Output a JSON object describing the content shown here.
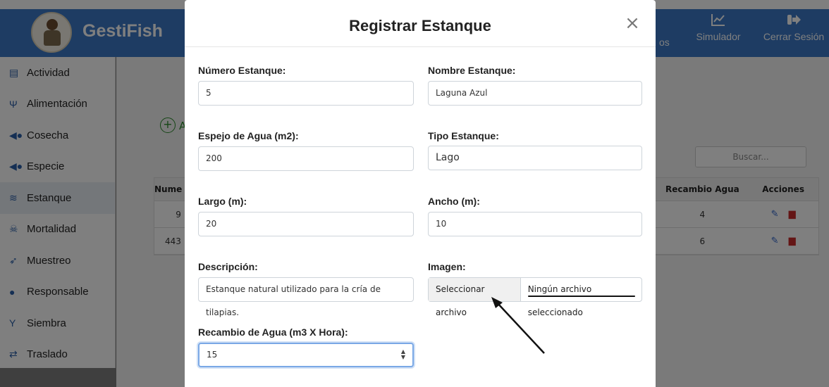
{
  "app": {
    "brand": "GestiFish",
    "top_nav": [
      {
        "label": "Simulador",
        "icon": "chart-line-icon"
      },
      {
        "label": "Cerrar Sesión",
        "icon": "sign-out-icon"
      }
    ],
    "nav_fragment": "os"
  },
  "sidebar": {
    "items": [
      {
        "label": "Actividad",
        "icon": "clipboard-icon"
      },
      {
        "label": "Alimentación",
        "icon": "utensils-icon"
      },
      {
        "label": "Cosecha",
        "icon": "fish-icon"
      },
      {
        "label": "Especie",
        "icon": "fish-icon"
      },
      {
        "label": "Estanque",
        "icon": "water-icon"
      },
      {
        "label": "Mortalidad",
        "icon": "skull-icon"
      },
      {
        "label": "Muestreo",
        "icon": "syringe-icon"
      },
      {
        "label": "Responsable",
        "icon": "user-icon"
      },
      {
        "label": "Siembra",
        "icon": "seedling-icon"
      },
      {
        "label": "Traslado",
        "icon": "exchange-icon"
      }
    ],
    "active": "Estanque"
  },
  "background_page": {
    "add_fragment": "A",
    "search_placeholder": "Buscar...",
    "table": {
      "headers": {
        "num": "Nume",
        "recambio": "Recambio Agua",
        "acciones": "Acciones"
      },
      "rows": [
        {
          "num": "9",
          "recambio": "4"
        },
        {
          "num": "443",
          "recambio": "6"
        }
      ]
    }
  },
  "modal": {
    "title": "Registrar Estanque",
    "fields": {
      "numero": {
        "label": "Número Estanque:",
        "value": "5"
      },
      "nombre": {
        "label": "Nombre Estanque:",
        "value": "Laguna Azul"
      },
      "espejo": {
        "label": "Espejo de Agua (m2):",
        "value": "200"
      },
      "tipo": {
        "label": "Tipo Estanque:",
        "value": "Lago"
      },
      "largo": {
        "label": "Largo (m):",
        "value": "20"
      },
      "ancho": {
        "label": "Ancho (m):",
        "value": "10"
      },
      "descripcion": {
        "label": "Descripción:",
        "value": "Estanque natural utilizado para la cría de tilapias."
      },
      "imagen": {
        "label": "Imagen:",
        "button": "Seleccionar archivo",
        "status": "Ningún archivo seleccionado"
      },
      "recambio": {
        "label": "Recambio de Agua (m3 X Hora):",
        "value": "15"
      }
    }
  },
  "colors": {
    "topbar": "#3c79c6",
    "focus": "#7aa8e6"
  }
}
